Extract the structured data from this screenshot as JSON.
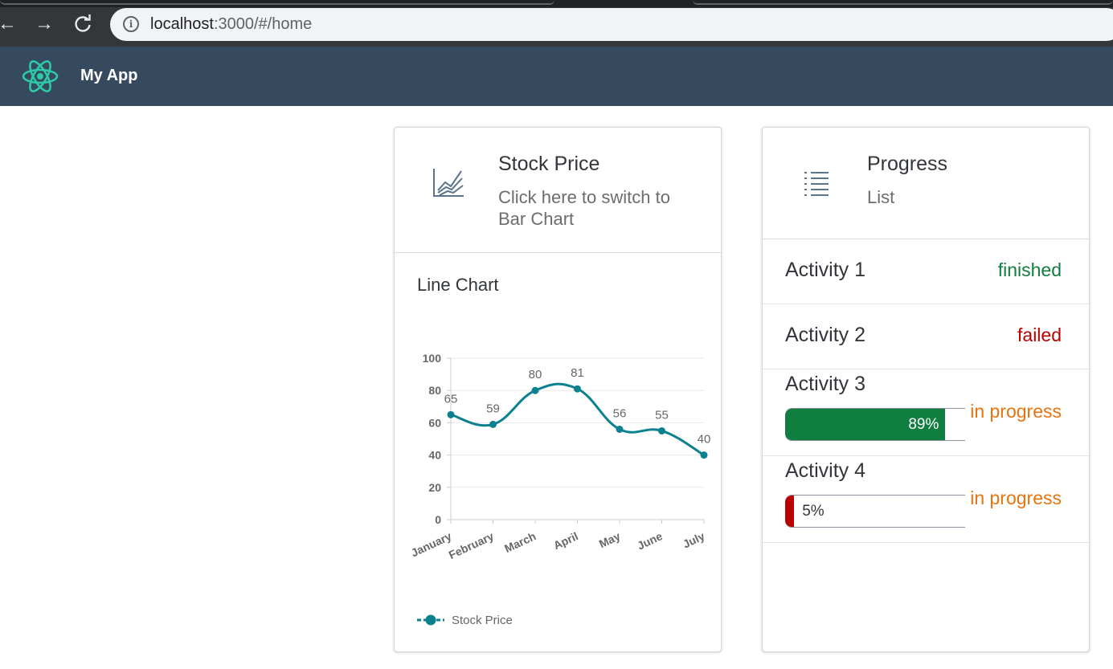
{
  "browser": {
    "url_host": "localhost",
    "url_rest": ":3000/#/home"
  },
  "app": {
    "title": "My App"
  },
  "stock_card": {
    "title": "Stock Price",
    "subtitle": "Click here to switch to Bar Chart",
    "chart_label": "Line Chart"
  },
  "chart_data": {
    "type": "line",
    "categories": [
      "January",
      "February",
      "March",
      "April",
      "May",
      "June",
      "July"
    ],
    "series": [
      {
        "name": "Stock Price",
        "values": [
          65,
          59,
          80,
          81,
          56,
          55,
          40
        ],
        "color": "#0b8190"
      }
    ],
    "ylim": [
      0,
      100
    ],
    "yticks": [
      0,
      20,
      40,
      60,
      80,
      100
    ],
    "data_labels": true,
    "grid": true,
    "legend_position": "bottom-left",
    "smooth": true
  },
  "progress_card": {
    "title": "Progress",
    "subtitle": "List",
    "activities": [
      {
        "name": "Activity 1",
        "status": "finished",
        "status_color": "#107e3e"
      },
      {
        "name": "Activity 2",
        "status": "failed",
        "status_color": "#bb0000"
      },
      {
        "name": "Activity 3",
        "status": "in progress",
        "status_color": "#e9730c",
        "progress": 89,
        "progress_label": "89%",
        "bar_color": "#107e3e"
      },
      {
        "name": "Activity 4",
        "status": "in progress",
        "status_color": "#e9730c",
        "progress": 5,
        "progress_label": "5%",
        "bar_color": "#bb0000"
      }
    ]
  }
}
